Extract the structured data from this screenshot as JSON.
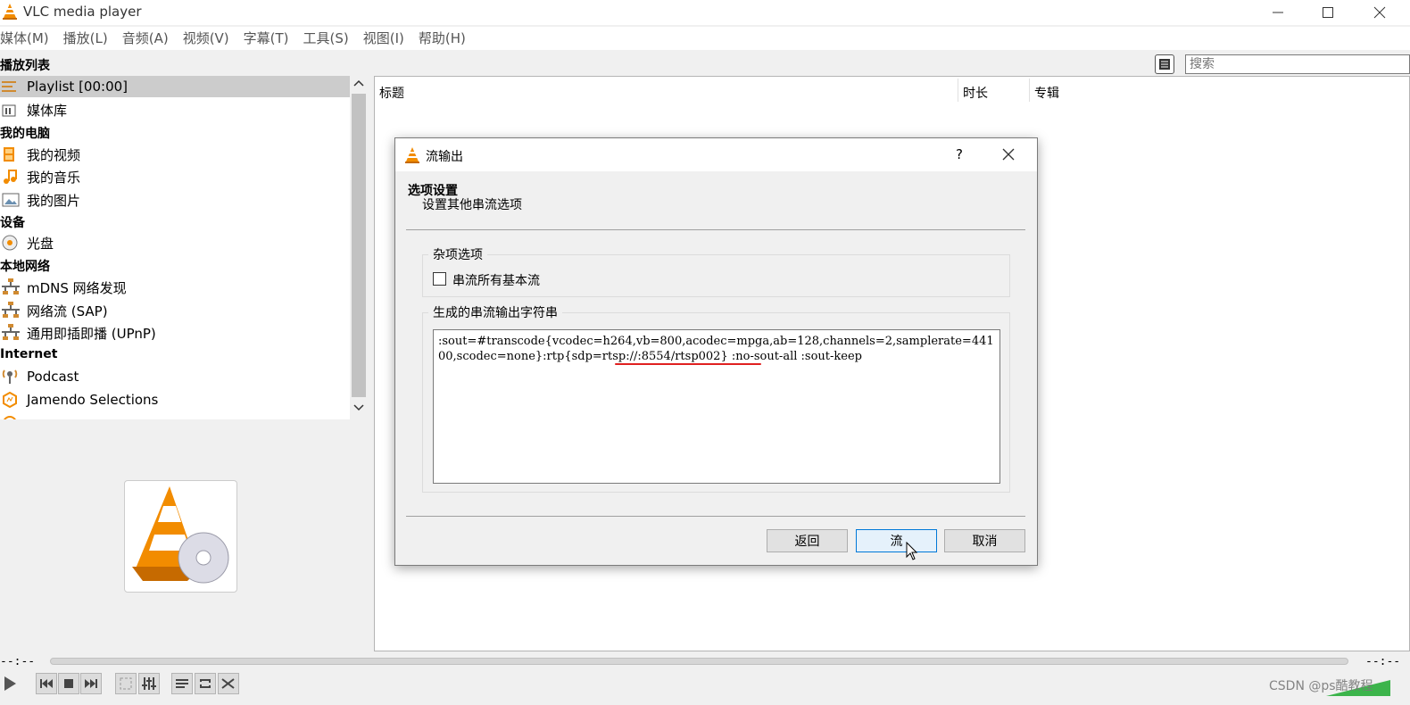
{
  "window": {
    "title": "VLC media player",
    "minimize_icon": "minimize-icon",
    "maximize_icon": "maximize-icon",
    "close_icon": "close-icon"
  },
  "menu": [
    "媒体(M)",
    "播放(L)",
    "音频(A)",
    "视频(V)",
    "字幕(T)",
    "工具(S)",
    "视图(I)",
    "帮助(H)"
  ],
  "playlist_header": "播放列表",
  "search": {
    "placeholder": "搜索"
  },
  "sidebar": {
    "items": [
      {
        "label": "Playlist [00:00]",
        "icon": "playlist-icon",
        "selected": true
      },
      {
        "label": "媒体库",
        "icon": "media-library-icon"
      }
    ],
    "sections": [
      {
        "title": "我的电脑",
        "items": [
          {
            "label": "我的视频",
            "icon": "film-icon"
          },
          {
            "label": "我的音乐",
            "icon": "music-note-icon"
          },
          {
            "label": "我的图片",
            "icon": "picture-icon"
          }
        ]
      },
      {
        "title": "设备",
        "items": [
          {
            "label": "光盘",
            "icon": "disc-icon"
          }
        ]
      },
      {
        "title": "本地网络",
        "items": [
          {
            "label": "mDNS 网络发现",
            "icon": "network-icon"
          },
          {
            "label": "网络流 (SAP)",
            "icon": "network-icon"
          },
          {
            "label": "通用即插即播 (UPnP)",
            "icon": "network-icon"
          }
        ]
      },
      {
        "title": "Internet",
        "items": [
          {
            "label": "Podcast",
            "icon": "podcast-icon"
          },
          {
            "label": "Jamendo Selections",
            "icon": "jamendo-icon"
          }
        ]
      }
    ]
  },
  "columns": [
    "标题",
    "时长",
    "专辑"
  ],
  "dialog": {
    "title": "流输出",
    "help": "?",
    "heading": "选项设置",
    "subheading": "设置其他串流选项",
    "misc_group": "杂项选项",
    "checkbox_label": "串流所有基本流",
    "checkbox_checked": false,
    "mrl_group": "生成的串流输出字符串",
    "mrl_value": ":sout=#transcode{vcodec=h264,vb=800,acodec=mpga,ab=128,channels=2,samplerate=44100,scodec=none}:rtp{sdp=rtsp://:8554/rtsp002} :no-sout-all :sout-keep",
    "buttons": {
      "back": "返回",
      "stream": "流",
      "cancel": "取消"
    }
  },
  "player": {
    "time_left": "--:--",
    "time_right": "--:--",
    "progress": 0
  },
  "watermark": "CSDN @ps酷教程",
  "colors": {
    "accent": "#0078d7",
    "cone": "#f28c00",
    "underline": "#e02020"
  }
}
